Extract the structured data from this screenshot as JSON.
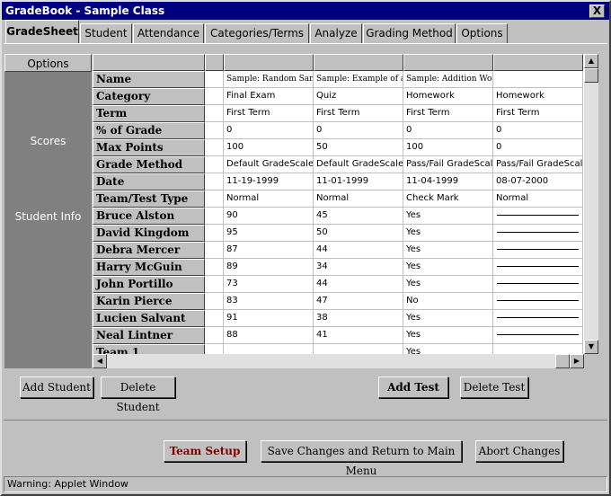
{
  "window": {
    "title": "GradeBook - Sample Class",
    "close_label": "X"
  },
  "tabs": [
    "GradeSheet",
    "Student",
    "Attendance",
    "Categories/Terms",
    "Analyze",
    "Grading Method",
    "Options"
  ],
  "left": {
    "options_label": "Options",
    "scores_label": "Scores",
    "student_info_label": "Student Info"
  },
  "rows": [
    "Name",
    "Category",
    "Term",
    "% of Grade",
    "Max Points",
    "Grade Method",
    "Date",
    "Team/Test Type",
    "Bruce Alston",
    "David Kingdom",
    "Debra Mercer",
    "Harry McGuin",
    "John Portillo",
    "Karin Pierce",
    "Lucien Salvant",
    "Neal Lintner",
    "Team 1"
  ],
  "columns": [
    [
      "Sample: Random Samp",
      "Final Exam",
      "First Term",
      "0",
      "100",
      "Default GradeScale",
      "11-19-1999",
      "Normal",
      "90",
      "95",
      "87",
      "89",
      "73",
      "83",
      "91",
      "88",
      ""
    ],
    [
      "Sample: Example of all",
      "Quiz",
      "First Term",
      "0",
      "50",
      "Default GradeScale",
      "11-01-1999",
      "Normal",
      "45",
      "50",
      "44",
      "34",
      "44",
      "47",
      "38",
      "41",
      ""
    ],
    [
      "Sample: Addition Work",
      "Homework",
      "First Term",
      "0",
      "100",
      "Pass/Fail GradeScale",
      "11-04-1999",
      "Check Mark",
      "Yes",
      "Yes",
      "Yes",
      "Yes",
      "Yes",
      "No",
      "Yes",
      "Yes",
      "Yes"
    ],
    [
      "",
      "Homework",
      "First Term",
      "0",
      "0",
      "Pass/Fail GradeScale",
      "08-07-2000",
      "Normal",
      "—",
      "—",
      "—",
      "—",
      "—",
      "—",
      "—",
      "—",
      ""
    ]
  ],
  "buttons": {
    "add_student": "Add Student",
    "delete_student": "Delete Student",
    "add_test": "Add Test",
    "delete_test": "Delete Test",
    "team_setup": "Team Setup",
    "save_return": "Save Changes and Return to Main Menu",
    "abort": "Abort Changes"
  },
  "status": "Warning: Applet Window",
  "colors": {
    "title_bar": "#000080",
    "team_setup_text": "#800000",
    "face": "#c0c0c0"
  }
}
